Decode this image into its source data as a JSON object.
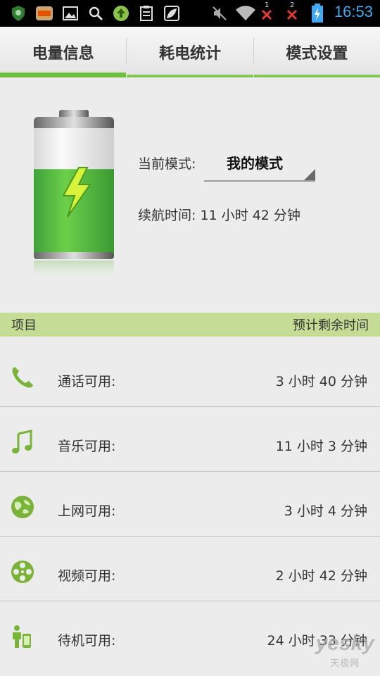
{
  "status_bar": {
    "time": "16:53",
    "icons": [
      "shield-app-icon",
      "game-app-icon",
      "image-icon",
      "search-icon",
      "upload-icon",
      "clipboard-icon",
      "leaf-icon",
      "mute-icon",
      "wifi-icon",
      "signal-1-icon",
      "signal-2-icon",
      "battery-charging-icon"
    ],
    "sim1_label": "1",
    "sim2_label": "2"
  },
  "tabs": [
    {
      "label": "电量信息",
      "active": true
    },
    {
      "label": "耗电统计",
      "active": false
    },
    {
      "label": "模式设置",
      "active": false
    }
  ],
  "battery": {
    "charging": true,
    "level_fraction": 0.68,
    "mode_label": "当前模式:",
    "mode_value": "我的模式",
    "runtime": "续航时间: 11 小时 42 分钟"
  },
  "list_header": {
    "left": "项目",
    "right": "预计剩余时间"
  },
  "items": [
    {
      "icon": "phone-icon",
      "label": "通话可用:",
      "value": "3 小时 40 分钟"
    },
    {
      "icon": "music-note-icon",
      "label": "音乐可用:",
      "value": "11 小时 3 分钟"
    },
    {
      "icon": "globe-icon",
      "label": "上网可用:",
      "value": "3 小时 4 分钟"
    },
    {
      "icon": "film-reel-icon",
      "label": "视频可用:",
      "value": "2 小时 42 分钟"
    },
    {
      "icon": "standby-person-icon",
      "label": "待机可用:",
      "value": "24 小时 33 分钟"
    }
  ],
  "watermark": {
    "line1": "yesky",
    "line2": "天极网"
  },
  "colors": {
    "accent_green": "#6cbf3a",
    "header_green": "#c4dc94",
    "clock_blue": "#3fa9f5",
    "icon_green": "#7ab33a"
  }
}
